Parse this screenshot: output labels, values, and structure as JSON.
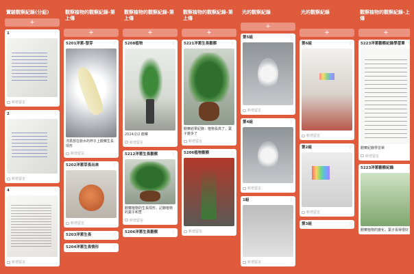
{
  "columns": [
    {
      "title": "實驗觀察紀錄(分組)",
      "add_label": "+",
      "cards": [
        {
          "title": "1",
          "photo": "whiteboard",
          "h": 86,
          "caption": "",
          "reply": "新增留言"
        },
        {
          "title": "2",
          "photo": "whiteboard",
          "h": 80,
          "caption": "",
          "reply": "新增留言"
        },
        {
          "title": "4",
          "photo": "paper",
          "h": 90,
          "caption": "",
          "reply": "新增留言"
        }
      ]
    },
    {
      "title": "觀察植物的觀察紀錄-第上傳",
      "add_label": "+",
      "cards": [
        {
          "title": "5201洋蔥-發芽",
          "photo": "glass",
          "h": 130,
          "caption": "洋蔥放在裝水的杯子上觀察生長情形",
          "reply": "新增留言"
        },
        {
          "title": "5202洋蔥芽長出來",
          "photo": "onion",
          "h": 70,
          "caption": "",
          "reply": "新增留言"
        },
        {
          "title": "5203洋蔥生長",
          "photo": "",
          "h": 0,
          "caption": "",
          "reply": ""
        },
        {
          "title": "5204洋蔥生長情形",
          "photo": "",
          "h": 0,
          "caption": "",
          "reply": ""
        }
      ]
    },
    {
      "title": "觀察植物的觀察紀錄-第上傳",
      "add_label": "+",
      "cards": [
        {
          "title": "5208植物",
          "photo": "plant",
          "h": 120,
          "caption": "2024/2/2 觀察",
          "reply": "新增留言"
        },
        {
          "title": "5212洋蔥生長觀察",
          "photo": "plantbig",
          "h": 66,
          "caption": "觀察植物的生長情形，記錄植物的葉子和莖",
          "reply": "新增留言"
        },
        {
          "title": "5206洋蔥生長觀察",
          "photo": "",
          "h": 0,
          "caption": "",
          "reply": ""
        }
      ]
    },
    {
      "title": "觀察植物的觀察紀錄-第上傳",
      "add_label": "+",
      "cards": [
        {
          "title": "5221洋蔥生長觀察",
          "photo": "plantbig",
          "h": 112,
          "caption": "觀察結果紀錄：植物長高了，葉子變多了",
          "reply": "新增留言"
        },
        {
          "title": "5206植物觀察",
          "photo": "redroom",
          "h": 100,
          "caption": "",
          "reply": "新增留言"
        }
      ]
    },
    {
      "title": "光的觀察紀錄",
      "add_label": "+",
      "cards": [
        {
          "title": "第5組",
          "photo": "dish",
          "h": 92,
          "caption": "",
          "reply": "新增留言"
        },
        {
          "title": "第4組",
          "photo": "dish",
          "h": 82,
          "caption": "",
          "reply": "新增留言"
        },
        {
          "title": "1組",
          "photo": "table",
          "h": 76,
          "caption": "",
          "reply": "新增留言"
        }
      ]
    },
    {
      "title": "光的觀察紀錄",
      "add_label": "+",
      "cards": [
        {
          "title": "第6組",
          "photo": "room",
          "h": 120,
          "caption": "",
          "reply": "新增留言"
        },
        {
          "title": "第2組",
          "photo": "spectrum",
          "h": 80,
          "caption": "",
          "reply": "新增留言"
        },
        {
          "title": "第3組",
          "photo": "",
          "h": 0,
          "caption": "",
          "reply": ""
        }
      ]
    },
    {
      "title": "觀察植物的觀察紀錄-上傳",
      "add_label": "+",
      "cards": [
        {
          "title": "5223洋蔥觀察紀錄學習單",
          "photo": "worksheet",
          "h": 140,
          "caption": "觀察紀錄學習單",
          "reply": "新增留言"
        },
        {
          "title": "5223洋蔥觀察紀錄",
          "photo": "greenhouse",
          "h": 78,
          "caption": "觀察植物的變化，葉子長得很好",
          "reply": ""
        }
      ]
    }
  ],
  "colors": {
    "background": "#e05a3c",
    "card": "#ffffff"
  },
  "icons": {
    "menu": "more-vertical-icon",
    "reply": "comment-icon"
  }
}
